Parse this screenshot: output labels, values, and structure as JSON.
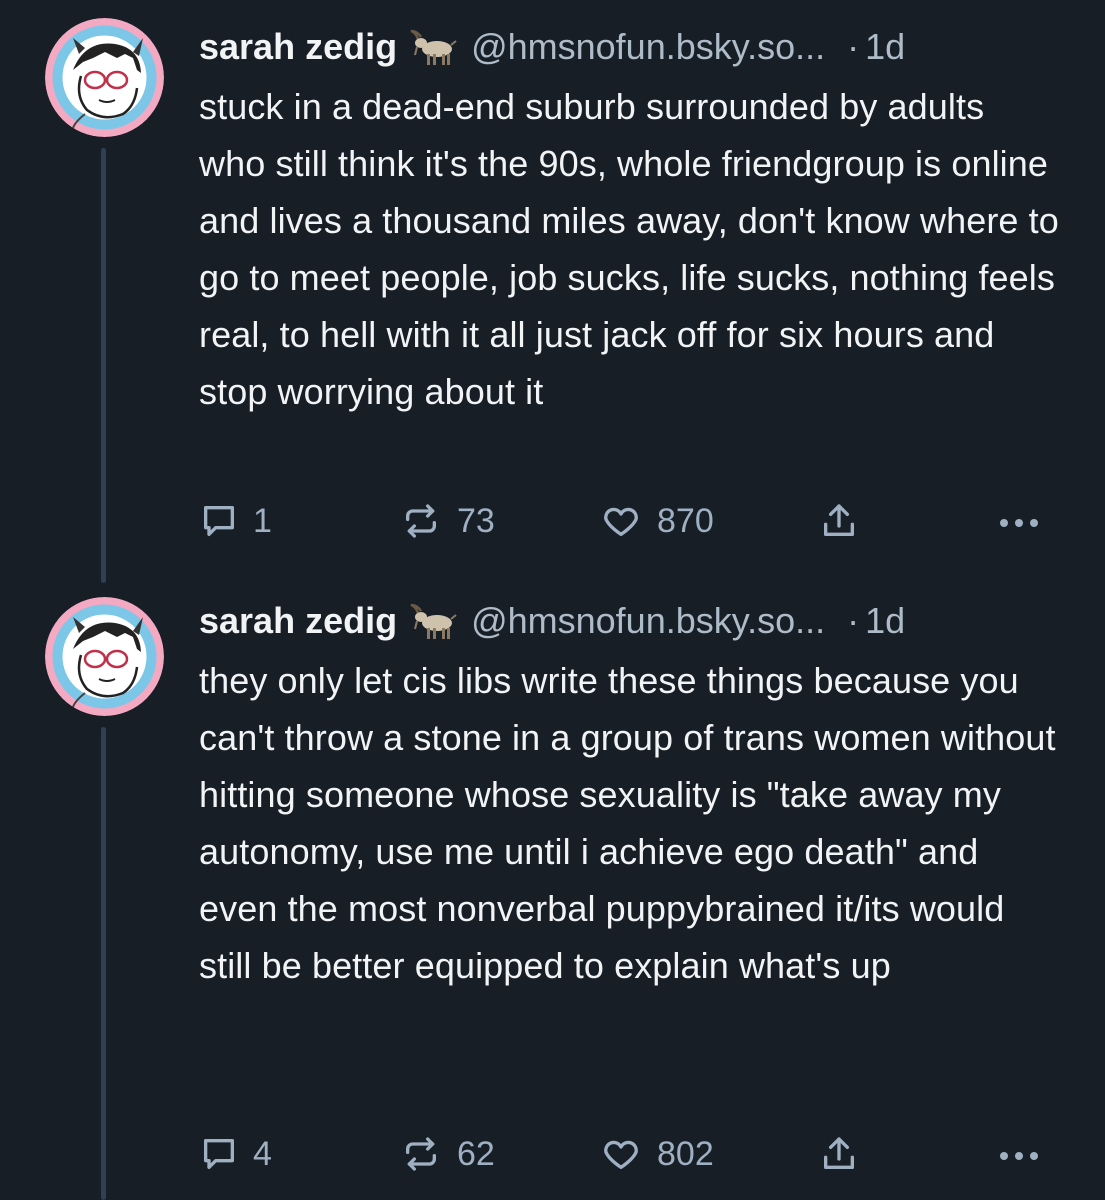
{
  "colors": {
    "background": "#171e26",
    "text": "#f1f3f5",
    "muted": "#aebbc9",
    "icon": "#9fb0c3",
    "thread_line": "#2e4052",
    "avatar_pink": "#f4a9c3",
    "avatar_blue": "#7cc6e8"
  },
  "posts": [
    {
      "display_name": "sarah zedig",
      "name_emoji": "goat-emoji",
      "handle": "@hmsnofun.bsky.so...",
      "separator": "·",
      "time": "1d",
      "text": "stuck in a dead-end suburb surrounded by adults who still think it's the 90s, whole friendgroup is online and lives a thousand miles away, don't know where to go to meet people, job sucks, life sucks, nothing feels real, to hell with it all just jack off for six hours and stop worrying about it",
      "replies": "1",
      "reposts": "73",
      "likes": "870"
    },
    {
      "display_name": "sarah zedig",
      "name_emoji": "goat-emoji",
      "handle": "@hmsnofun.bsky.so...",
      "separator": "·",
      "time": "1d",
      "text": "they only let cis libs write these things because you can't throw a stone in a group of trans women without hitting someone whose sexuality is \"take away my autonomy, use me until i achieve ego death\" and even the most nonverbal puppybrained it/its would still be better equipped to explain what's up",
      "replies": "4",
      "reposts": "62",
      "likes": "802"
    }
  ]
}
